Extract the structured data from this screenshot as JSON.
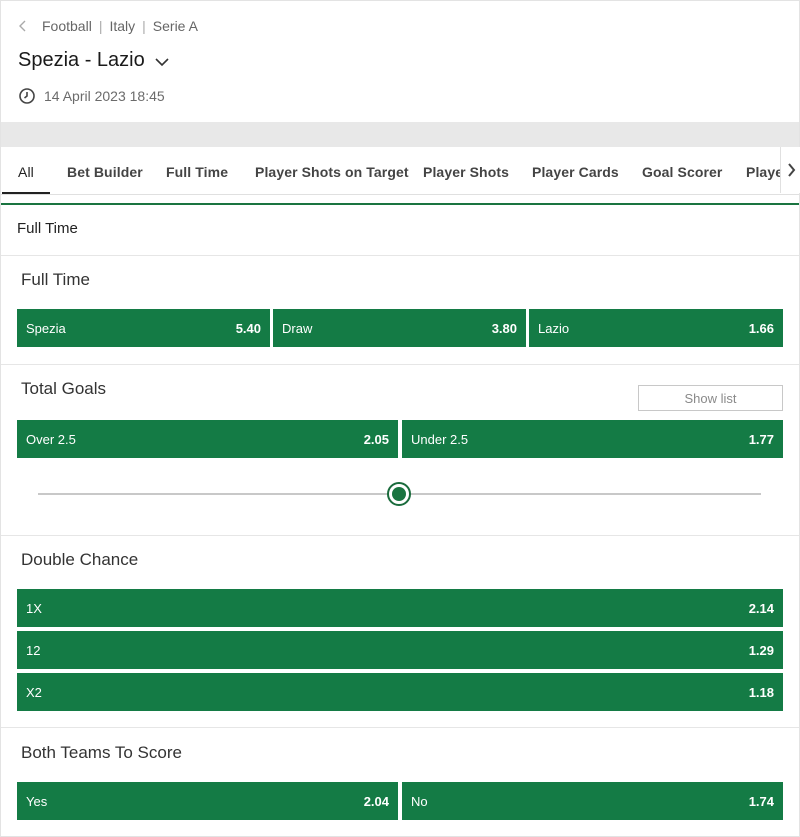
{
  "breadcrumb": {
    "items": [
      "Football",
      "Italy",
      "Serie A"
    ]
  },
  "event": {
    "title": "Spezia - Lazio",
    "datetime": "14 April 2023 18:45"
  },
  "tabs": [
    "All",
    "Bet Builder",
    "Full Time",
    "Player Shots on Target",
    "Player Shots",
    "Player Cards",
    "Goal Scorer",
    "Player"
  ],
  "group_title": "Full Time",
  "markets": {
    "full_time": {
      "title": "Full Time",
      "selections": [
        {
          "label": "Spezia",
          "odds": "5.40"
        },
        {
          "label": "Draw",
          "odds": "3.80"
        },
        {
          "label": "Lazio",
          "odds": "1.66"
        }
      ]
    },
    "total_goals": {
      "title": "Total Goals",
      "show_list": "Show list",
      "selections": [
        {
          "label": "Over 2.5",
          "odds": "2.05"
        },
        {
          "label": "Under 2.5",
          "odds": "1.77"
        }
      ],
      "slider_position": 0.5
    },
    "double_chance": {
      "title": "Double Chance",
      "selections": [
        {
          "label": "1X",
          "odds": "2.14"
        },
        {
          "label": "12",
          "odds": "1.29"
        },
        {
          "label": "X2",
          "odds": "1.18"
        }
      ]
    },
    "btts": {
      "title": "Both Teams To Score",
      "selections": [
        {
          "label": "Yes",
          "odds": "2.04"
        },
        {
          "label": "No",
          "odds": "1.74"
        }
      ]
    }
  },
  "colors": {
    "odds_button": "#147b45",
    "accent_line": "#1a7440"
  },
  "icons": {
    "back": "chevron-left-icon",
    "title_dropdown": "chevron-down-icon",
    "time": "clock-icon",
    "tabs_scroll": "chevron-right-icon"
  }
}
